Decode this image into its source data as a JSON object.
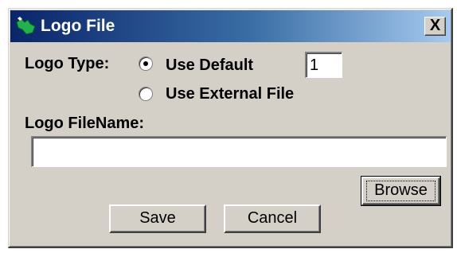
{
  "window": {
    "title": "Logo File",
    "close_label": "X"
  },
  "form": {
    "logo_type_label": "Logo Type:",
    "radio_default_label": "Use Default",
    "radio_external_label": "Use External File",
    "selected_option": "Use Default",
    "default_number_value": "1",
    "filename_label": "Logo FileName:",
    "filename_value": ""
  },
  "buttons": {
    "browse_label": "Browse",
    "save_label": "Save",
    "cancel_label": "Cancel"
  },
  "colors": {
    "titlebar_start": "#0a246a",
    "titlebar_end": "#a6caf0",
    "dialog_face": "#d4d0c8"
  }
}
